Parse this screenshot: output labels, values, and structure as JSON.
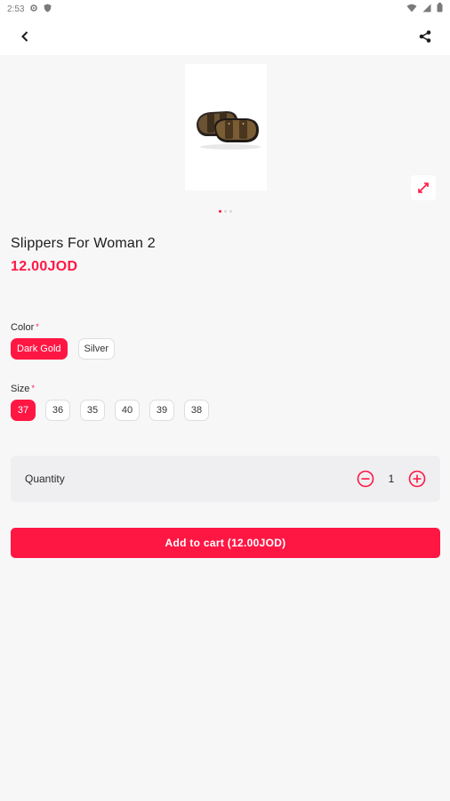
{
  "status_bar": {
    "time": "2:53"
  },
  "product": {
    "title": "Slippers For Woman 2",
    "price": "12.00JOD",
    "image_count": 3,
    "active_image": 1
  },
  "options": {
    "color": {
      "label": "Color",
      "required_mark": "*",
      "values": [
        "Dark Gold",
        "Silver"
      ],
      "selected": "Dark Gold"
    },
    "size": {
      "label": "Size",
      "required_mark": "*",
      "values": [
        "37",
        "36",
        "35",
        "40",
        "39",
        "38"
      ],
      "selected": "37"
    }
  },
  "quantity": {
    "label": "Quantity",
    "value": "1"
  },
  "cart": {
    "button_label": "Add to cart (12.00JOD)"
  },
  "theme": {
    "accent": "#ff1744",
    "background": "#f7f7f8"
  }
}
